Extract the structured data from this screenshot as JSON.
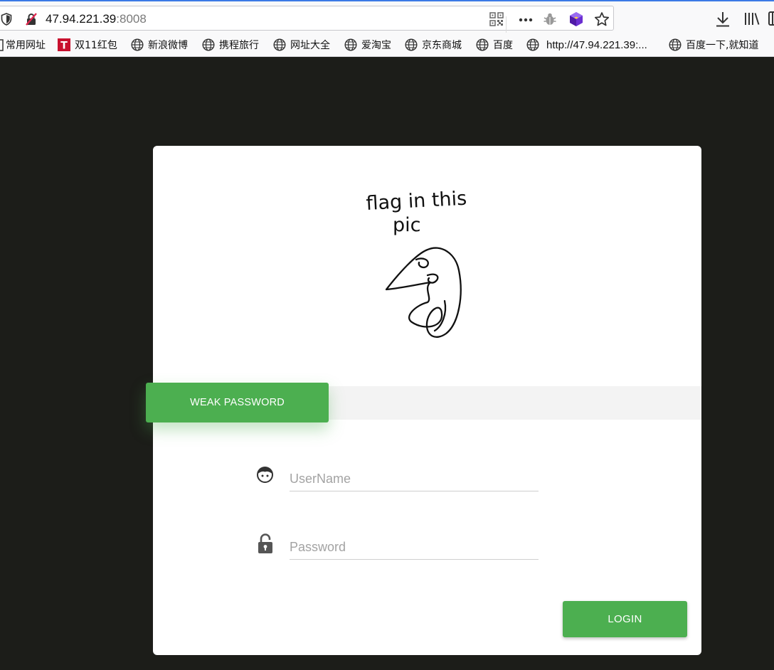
{
  "browser": {
    "url_host": "47.94.221.39",
    "url_port": ":8008",
    "bookmarks": [
      {
        "label": "常用网址",
        "icon": "folder-icon"
      },
      {
        "label": "双11红包",
        "icon": "tmall-icon"
      },
      {
        "label": "新浪微博",
        "icon": "globe-icon"
      },
      {
        "label": "携程旅行",
        "icon": "globe-icon"
      },
      {
        "label": "网址大全",
        "icon": "globe-icon"
      },
      {
        "label": "爱淘宝",
        "icon": "globe-icon"
      },
      {
        "label": "京东商城",
        "icon": "globe-icon"
      },
      {
        "label": "百度",
        "icon": "globe-icon"
      },
      {
        "label": "http://47.94.221.39:...",
        "icon": "globe-icon"
      },
      {
        "label": "百度一下,就知道",
        "icon": "globe-icon"
      }
    ]
  },
  "login": {
    "doodle_caption_line1": "flag in this",
    "doodle_caption_line2": "pic",
    "tab_label": "WEAK PASSWORD",
    "username_placeholder": "UserName",
    "password_placeholder": "Password",
    "login_label": "LOGIN"
  },
  "colors": {
    "page_background": "#1c1d19",
    "accent_green": "#4caf50",
    "card_background": "#ffffff"
  }
}
